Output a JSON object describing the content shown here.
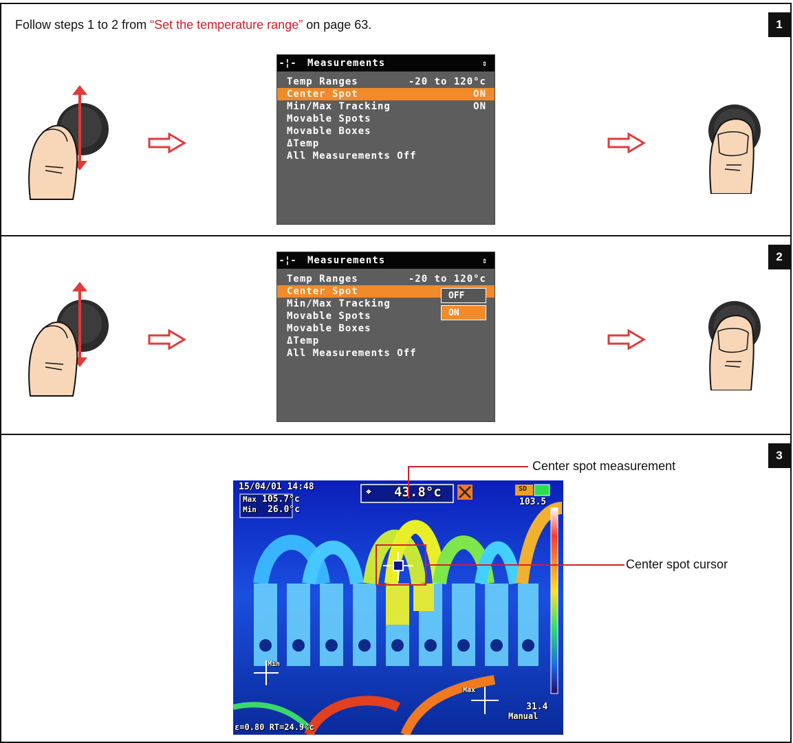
{
  "step1": {
    "badge": "1",
    "intro_prefix": "Follow steps 1 to 2 from ",
    "intro_link": "“Set the temperature range”",
    "intro_suffix": " on page 63."
  },
  "menu": {
    "title": "Measurements",
    "header_icon": "-¦-",
    "sort_icon": "⇕",
    "rows": [
      {
        "label": "Temp Ranges",
        "value": "-20 to 120°c"
      },
      {
        "label": "Center Spot",
        "value": "ON"
      },
      {
        "label": "Min/Max Tracking",
        "value": "ON"
      },
      {
        "label": "Movable Spots",
        "value": ""
      },
      {
        "label": "Movable Boxes",
        "value": ""
      },
      {
        "label": "ΔTemp",
        "value": ""
      },
      {
        "label": "All Measurements Off",
        "value": ""
      }
    ]
  },
  "step2": {
    "badge": "2",
    "popup_options": [
      "OFF",
      "ON"
    ]
  },
  "step3": {
    "badge": "3",
    "callout_measurement": "Center spot measurement",
    "callout_cursor": "Center spot cursor",
    "date_time": "15/04/01 14:48",
    "max_label": "Max",
    "max_value": "105.7°c",
    "min_label": "Min",
    "min_value": "26.0°c",
    "spot_value": "43.8°c",
    "sd_label": "SD",
    "scale_top": "103.5",
    "scale_bottom": "31.4",
    "mode": "Manual",
    "emissivity": "ε=0.80 RT=24.9°c",
    "min_marker": "Min",
    "max_marker": "Max"
  },
  "colors": {
    "accent_red": "#d21f2a",
    "menu_orange": "#f08a2a",
    "menu_gray": "#5d5d5d"
  }
}
